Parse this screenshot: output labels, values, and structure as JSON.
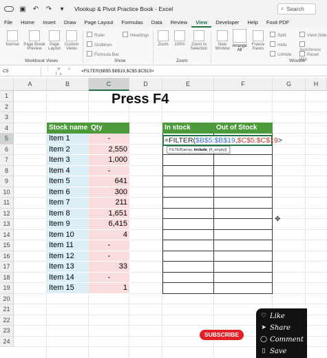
{
  "window": {
    "title": "Vlookup & Pivot Practice Book  -  Excel",
    "search_placeholder": "Search"
  },
  "menu_tabs": [
    "File",
    "Home",
    "Insert",
    "Draw",
    "Page Layout",
    "Formulas",
    "Data",
    "Review",
    "View",
    "Developer",
    "Help",
    "Foxit PDF"
  ],
  "active_tab": "View",
  "ribbon": {
    "normal": "Normal",
    "page_break": "Page Break Preview",
    "page_layout": "Page Layout",
    "custom_views": "Custom Views",
    "workbook_views": "Workbook Views",
    "ruler": "Ruler",
    "gridlines": "Gridlines",
    "formula_bar": "Formula Bar",
    "headings": "Headings",
    "show": "Show",
    "zoom": "Zoom",
    "zoom_100": "100%",
    "zoom_to_selection": "Zoom to Selection",
    "zoom_group": "Zoom",
    "new_window": "New Window",
    "arrange_all": "Arrange All",
    "freeze_panes": "Freeze Panes",
    "split": "Split",
    "hide": "Hide",
    "unhide": "Unhide",
    "view_side": "View Side",
    "synchronous": "Synchrono",
    "reset_window": "Reset Win",
    "window_group": "Window"
  },
  "formula_bar": {
    "name_box": "C5",
    "icons": "⋮ ✕ ✓ fx",
    "formula": "=FILTER($B$5:$B$19,$C$5:$C$19>"
  },
  "columns": [
    "A",
    "B",
    "C",
    "D",
    "E",
    "F",
    "G",
    "H"
  ],
  "rows": [
    "1",
    "2",
    "3",
    "4",
    "5",
    "6",
    "7",
    "8",
    "9",
    "10",
    "11",
    "12",
    "13",
    "14",
    "15",
    "16",
    "17",
    "18",
    "19",
    "20",
    "21",
    "22",
    "23",
    "24"
  ],
  "heading": "Press F4",
  "table": {
    "header_stock": "Stock name",
    "header_qty": "Qty",
    "items": [
      {
        "name": "Item 1",
        "qty": "-"
      },
      {
        "name": "Item 2",
        "qty": "2,550"
      },
      {
        "name": "Item 3",
        "qty": "1,000"
      },
      {
        "name": "Item 4",
        "qty": "-"
      },
      {
        "name": "Item 5",
        "qty": "641"
      },
      {
        "name": "Item 6",
        "qty": "300"
      },
      {
        "name": "Item 7",
        "qty": "211"
      },
      {
        "name": "Item 8",
        "qty": "1,651"
      },
      {
        "name": "Item 9",
        "qty": "6,415"
      },
      {
        "name": "Item 10",
        "qty": "4"
      },
      {
        "name": "Item 11",
        "qty": "-"
      },
      {
        "name": "Item 12",
        "qty": "-"
      },
      {
        "name": "Item 13",
        "qty": "33"
      },
      {
        "name": "Item 14",
        "qty": "-"
      },
      {
        "name": "Item 15",
        "qty": "1"
      }
    ]
  },
  "result": {
    "header_in": "In stock",
    "header_out": "Out of Stock",
    "formula_prefix": "=FILTER(",
    "formula_ref1": "$B$5:$B$19",
    "formula_comma": ",",
    "formula_ref2": "$C$5:$C$19",
    "formula_suffix": ">",
    "tooltip_fn": "FILTER(array, ",
    "tooltip_bold": "include",
    "tooltip_rest": ", [if_empty])"
  },
  "overlay": {
    "subscribe": "SUBSCRIBE",
    "like": "Like",
    "share": "Share",
    "comment": "Comment",
    "save": "Save"
  },
  "colors": {
    "excel_green": "#217346",
    "header_green": "#4d9a3c",
    "stock_fill": "#dceff6",
    "qty_fill": "#f9dcdc",
    "subscribe_red": "#e32026"
  }
}
